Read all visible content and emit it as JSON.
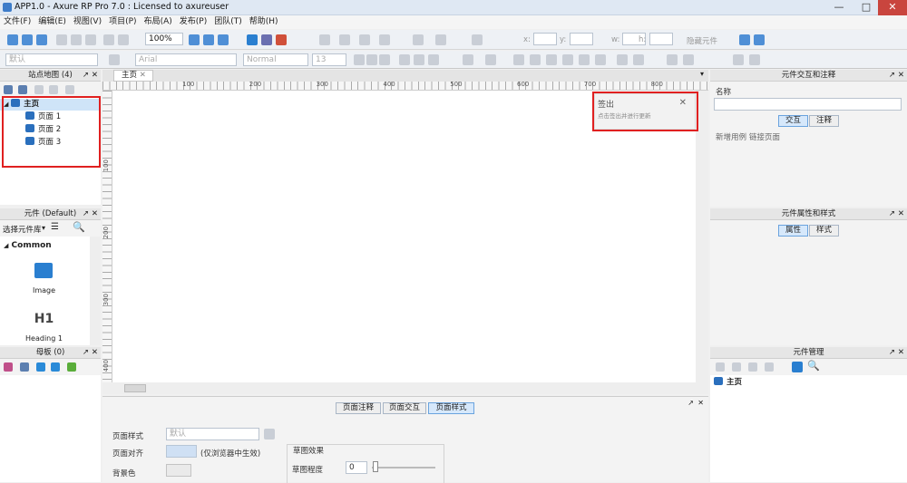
{
  "title_bar": {
    "title": "APP1.0 - Axure RP Pro 7.0 : Licensed to axureuser",
    "minimize": "—",
    "maximize": "□",
    "close": "✕"
  },
  "menu": [
    "文件(F)",
    "编辑(E)",
    "视图(V)",
    "项目(P)",
    "布局(A)",
    "发布(P)",
    "团队(T)",
    "帮助(H)"
  ],
  "toolbar": {
    "zoom": "100%",
    "hide_widget": "隐藏元件",
    "x_label": "x:",
    "y_label": "y:",
    "w_label": "w:",
    "h_label": "h:"
  },
  "format_bar": {
    "style": "默认",
    "font": "Arial",
    "weight": "Normal",
    "size": "13"
  },
  "sitemap": {
    "header": "站点地图 (4)",
    "items": [
      {
        "label": "主页"
      },
      {
        "label": "页面 1"
      },
      {
        "label": "页面 2"
      },
      {
        "label": "页面 3"
      }
    ]
  },
  "widgets": {
    "header": "元件 (Default)",
    "library_select": "选择元件库",
    "group": "Common",
    "items": [
      {
        "label": "Image"
      },
      {
        "label": "Heading 1",
        "icon_text": "H1"
      }
    ]
  },
  "masters": {
    "header": "母板 (0)"
  },
  "canvas": {
    "tab": "主页",
    "ruler_marks": [
      "100",
      "200",
      "300",
      "400",
      "500",
      "600",
      "700",
      "800"
    ],
    "vruler_marks": [
      "100",
      "200",
      "300",
      "400"
    ]
  },
  "popup": {
    "title": "签出",
    "subtitle": "点击签出并进行更新"
  },
  "page_props": {
    "tabs": [
      "页面注释",
      "页面交互",
      "页面样式"
    ],
    "style_label": "页面样式",
    "style_value": "默认",
    "align_label": "页面对齐",
    "align_note": "(仅浏览器中生效)",
    "bg_label": "背景色",
    "sketch_group": "草图效果",
    "sketch_degree": "草图程度",
    "sketch_value": "0"
  },
  "interactions": {
    "header": "元件交互和注释",
    "name_label": "名称",
    "tabs": [
      "交互",
      "注释"
    ],
    "links": [
      "新增用例",
      "链接页面"
    ]
  },
  "properties": {
    "header": "元件属性和样式",
    "tabs": [
      "属性",
      "样式"
    ]
  },
  "manager": {
    "header": "元件管理",
    "items": [
      {
        "label": "主页"
      }
    ]
  },
  "colors": {
    "accent": "#2a6fbd",
    "highlight": "#e02020",
    "tab_active": "#d6e8fb"
  }
}
